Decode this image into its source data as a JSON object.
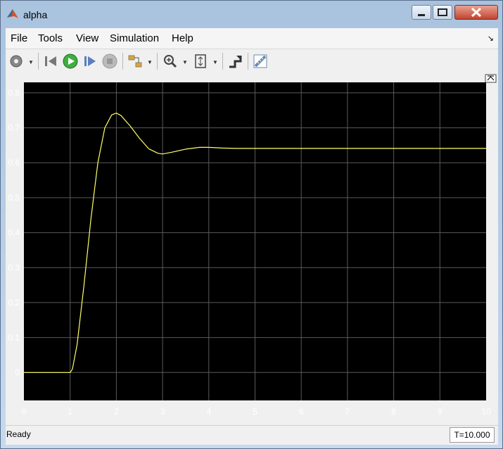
{
  "window": {
    "title": "alpha"
  },
  "menu": {
    "items": [
      "File",
      "Tools",
      "View",
      "Simulation",
      "Help"
    ]
  },
  "toolbar": {
    "buttons": [
      "settings-icon",
      "step-back-icon",
      "run-icon",
      "step-forward-icon",
      "stop-icon",
      "signal-selector-icon",
      "zoom-icon",
      "fit-axes-icon",
      "highlight-block-icon",
      "measure-icon"
    ]
  },
  "status": {
    "text": "Ready",
    "time": "T=10.000"
  },
  "colors": {
    "plot_bg": "#000000",
    "grid": "#5a5a5a",
    "signal": "#ffff66",
    "axis_text": "#ffffff"
  },
  "chart_data": {
    "type": "line",
    "title": "",
    "xlabel": "",
    "ylabel": "",
    "xlim": [
      0,
      10
    ],
    "ylim": [
      -0.08,
      0.83
    ],
    "x_ticks": [
      0,
      1,
      2,
      3,
      4,
      5,
      6,
      7,
      8,
      9,
      10
    ],
    "y_ticks": [
      0,
      0.1,
      0.2,
      0.3,
      0.4,
      0.5,
      0.6,
      0.7,
      0.8
    ],
    "grid": true,
    "series": [
      {
        "x": [
          0,
          1,
          1.05,
          1.15,
          1.3,
          1.45,
          1.6,
          1.75,
          1.9,
          2.0,
          2.1,
          2.3,
          2.5,
          2.7,
          2.9,
          3.0,
          3.2,
          3.5,
          3.8,
          4.0,
          4.3,
          4.6,
          5,
          6,
          7,
          8,
          9,
          10
        ],
        "y": [
          0,
          0,
          0.01,
          0.08,
          0.25,
          0.44,
          0.6,
          0.7,
          0.737,
          0.742,
          0.735,
          0.705,
          0.67,
          0.64,
          0.627,
          0.625,
          0.63,
          0.639,
          0.644,
          0.644,
          0.642,
          0.641,
          0.641,
          0.641,
          0.641,
          0.641,
          0.641,
          0.641
        ]
      }
    ]
  }
}
